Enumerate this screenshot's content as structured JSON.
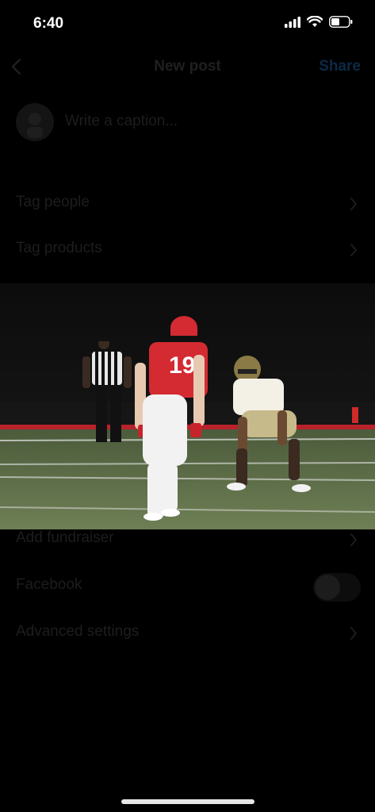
{
  "status_bar": {
    "time": "6:40"
  },
  "header": {
    "title": "New post",
    "share_label": "Share"
  },
  "caption": {
    "placeholder": "Write a caption..."
  },
  "options": {
    "tag_people": "Tag people",
    "tag_products": "Tag products",
    "add_fundraiser": "Add fundraiser",
    "facebook": "Facebook",
    "advanced_settings": "Advanced settings"
  },
  "toggles": {
    "facebook_enabled": false
  },
  "photo": {
    "jersey_number": "19",
    "icon": "photo-preview"
  },
  "colors": {
    "background": "#000000",
    "share_blue": "#0095f6",
    "jersey_red": "#d42a32"
  }
}
